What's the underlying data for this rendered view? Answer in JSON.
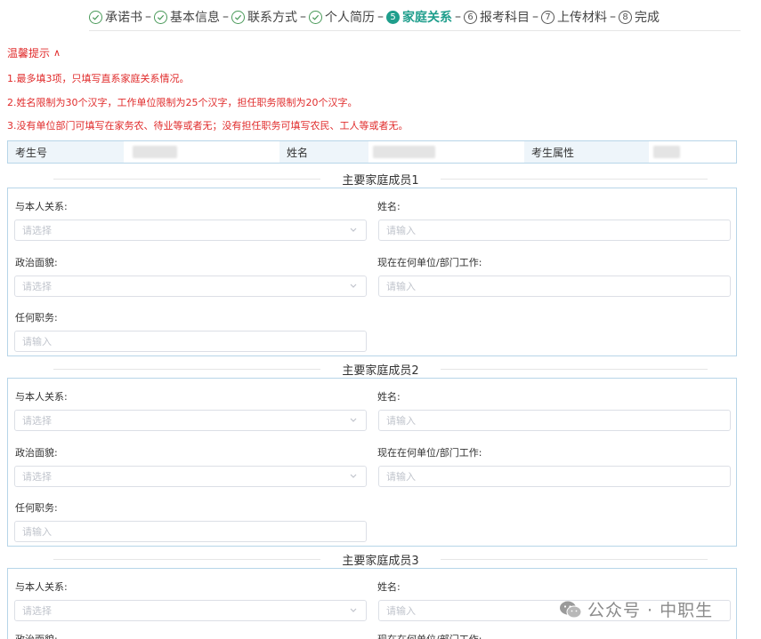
{
  "stepper": {
    "steps": [
      {
        "label": "承诺书",
        "state": "done",
        "num": ""
      },
      {
        "label": "基本信息",
        "state": "done",
        "num": ""
      },
      {
        "label": "联系方式",
        "state": "done",
        "num": ""
      },
      {
        "label": "个人简历",
        "state": "done",
        "num": ""
      },
      {
        "label": "家庭关系",
        "state": "active",
        "num": "5"
      },
      {
        "label": "报考科目",
        "state": "todo",
        "num": "6"
      },
      {
        "label": "上传材料",
        "state": "todo",
        "num": "7"
      },
      {
        "label": "完成",
        "state": "todo",
        "num": "8"
      }
    ]
  },
  "notice": {
    "title": "温馨提示",
    "lines": [
      "1.最多填3项，只填写直系家庭关系情况。",
      "2.姓名限制为30个汉字，工作单位限制为25个汉字，担任职务限制为20个汉字。",
      "3.没有单位部门可填写在家务农、待业等或者无；没有担任职务可填写农民、工人等或者无。"
    ]
  },
  "candidate": {
    "exam_no_label": "考生号",
    "name_label": "姓名",
    "attr_label": "考生属性"
  },
  "form": {
    "relation_label": "与本人关系:",
    "name_label": "姓名:",
    "political_label": "政治面貌:",
    "workplace_label": "现在在何单位/部门工作:",
    "position_label": "任何职务:",
    "select_placeholder": "请选择",
    "input_placeholder": "请输入"
  },
  "members": [
    {
      "title": "主要家庭成员1"
    },
    {
      "title": "主要家庭成员2"
    },
    {
      "title": "主要家庭成员3"
    }
  ],
  "watermark": {
    "text": "公众号 · 中职生"
  },
  "colors": {
    "accent": "#1f9e8c",
    "notice": "#e02b2b",
    "border": "#b7d5e8"
  }
}
